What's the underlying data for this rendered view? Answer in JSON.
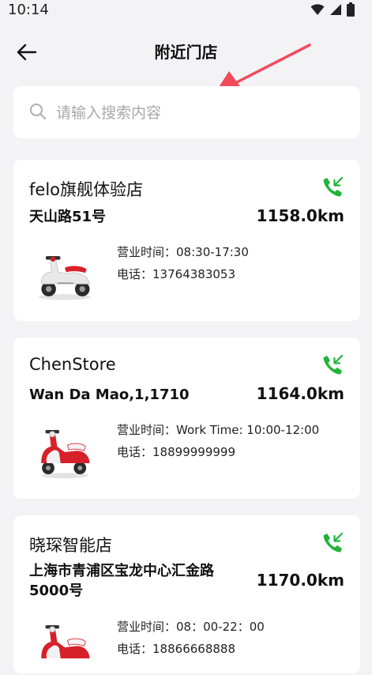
{
  "status_bar": {
    "time": "10:14"
  },
  "header": {
    "title": "附近门店",
    "back_icon": "arrow-left-icon"
  },
  "search": {
    "placeholder": "请输入搜索内容",
    "value": "",
    "icon": "search-icon"
  },
  "colors": {
    "accent_call": "#1fb33b",
    "annotation_arrow": "#f24a5a",
    "background": "#f3f3f5"
  },
  "stores": [
    {
      "name": "felo旗舰体验店",
      "address": "天山路51号",
      "distance": "1158.0km",
      "hours_label": "营业时间：",
      "hours": "08:30-17:30",
      "phone_label": "电话：",
      "phone": "13764383053"
    },
    {
      "name": "ChenStore",
      "address": "Wan Da Mao,1,1710",
      "distance": "1164.0km",
      "hours_label": "营业时间：",
      "hours": "Work Time: 10:00-12:00",
      "phone_label": "电话：",
      "phone": "18899999999"
    },
    {
      "name": "晓琛智能店",
      "address": "上海市青浦区宝龙中心汇金路5000号",
      "distance": "1170.0km",
      "hours_label": "营业时间：",
      "hours": "08：00-22：00",
      "phone_label": "电话：",
      "phone": "18866668888"
    }
  ]
}
